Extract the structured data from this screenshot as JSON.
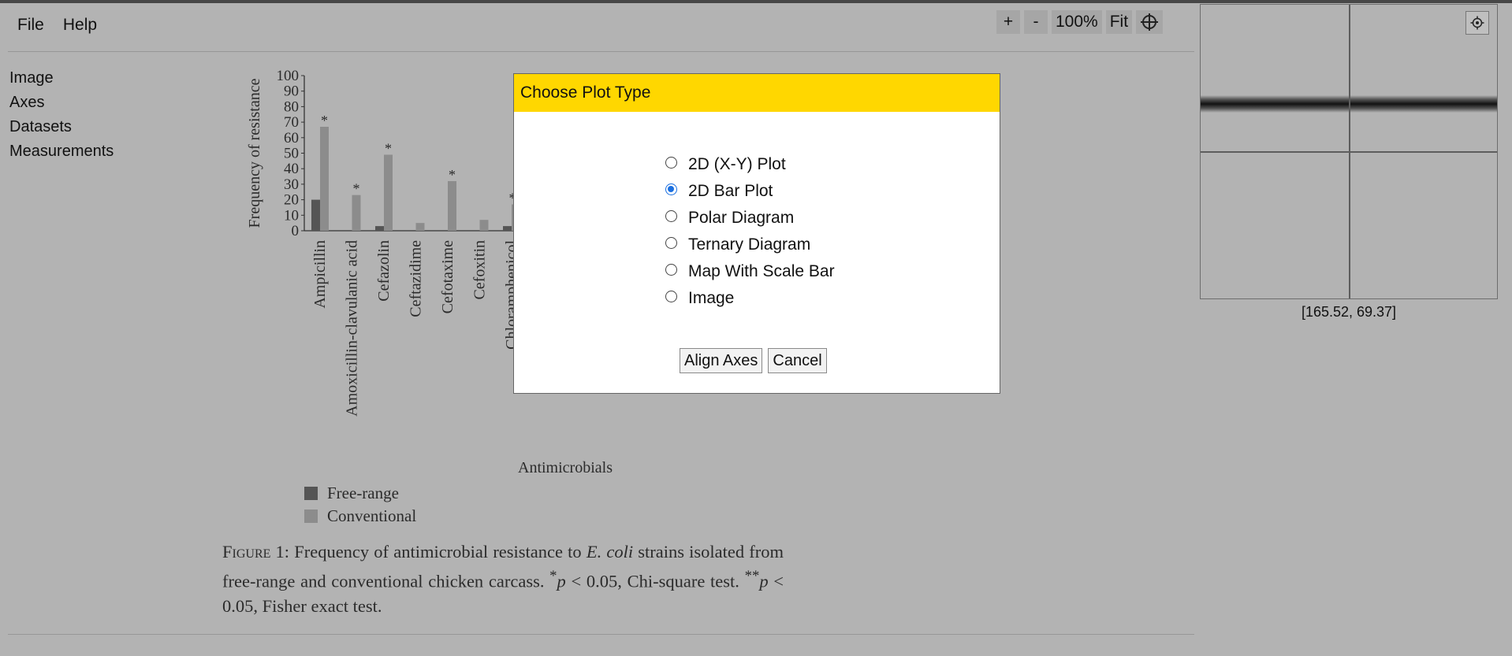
{
  "menu": {
    "file": "File",
    "help": "Help"
  },
  "sidenav": {
    "items": [
      "Image",
      "Axes",
      "Datasets",
      "Measurements"
    ]
  },
  "zoom": {
    "plus": "+",
    "minus": "-",
    "level": "100%",
    "fit": "Fit"
  },
  "magnifier": {
    "coordinates": "[165.52, 69.37]",
    "settings_icon": "gear-icon"
  },
  "dialog": {
    "title": "Choose Plot Type",
    "options": [
      "2D (X-Y) Plot",
      "2D Bar Plot",
      "Polar Diagram",
      "Ternary Diagram",
      "Map With Scale Bar",
      "Image"
    ],
    "selected": "2D Bar Plot",
    "align_button": "Align Axes",
    "cancel_button": "Cancel"
  },
  "figure": {
    "caption_lead": "Figure 1",
    "caption_text_1": ": Frequency of antimicrobial resistance to ",
    "caption_italic": "E. coli",
    "caption_text_2": " strains isolated from free-range and conventional chicken carcass. ",
    "caption_star1": "*",
    "caption_p1": "p",
    "caption_text_3": " < 0.05, Chi-square test. ",
    "caption_star2": "**",
    "caption_p2": "p",
    "caption_text_4": " < 0.05, Fisher exact test."
  },
  "chart_data": {
    "type": "bar",
    "ylabel": "Frequency of resistance",
    "xlabel": "Antimicrobials",
    "ylim": [
      0,
      100
    ],
    "yticks": [
      0,
      10,
      20,
      30,
      40,
      50,
      60,
      70,
      80,
      90,
      100
    ],
    "categories": [
      "Ampicillin",
      "Amoxicillin-clavulanic acid",
      "Cefazolin",
      "Ceftazidime",
      "Cefotaxime",
      "Cefoxitin",
      "Chloramphenicol"
    ],
    "series": [
      {
        "name": "Free-range",
        "color": "#555555",
        "values": [
          20,
          0,
          3,
          0,
          0,
          0,
          3
        ]
      },
      {
        "name": "Conventional",
        "color": "#8c8c8c",
        "values": [
          67,
          23,
          49,
          5,
          32,
          7,
          17
        ]
      }
    ],
    "annotations": [
      "*",
      "*",
      "*",
      "",
      "*",
      "",
      "**"
    ],
    "grid": false,
    "legend_position": "bottom-left"
  }
}
